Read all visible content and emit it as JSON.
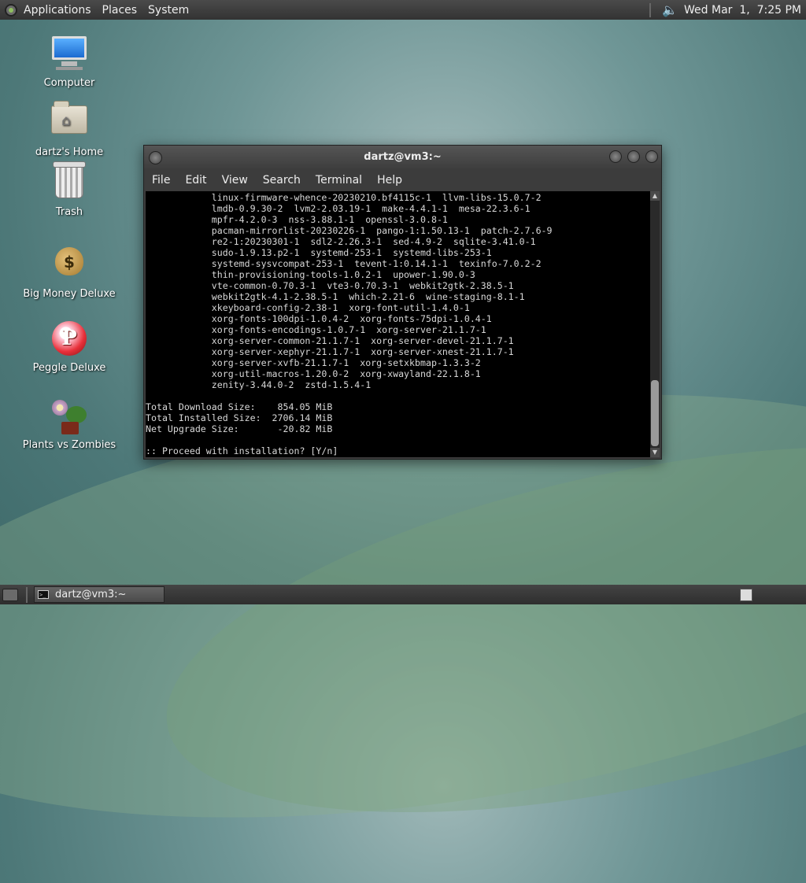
{
  "top_panel": {
    "menus": [
      "Applications",
      "Places",
      "System"
    ],
    "clock": "Wed Mar  1,  7:25 PM"
  },
  "desktop_icons": [
    {
      "label": "Computer",
      "icon": "computer-icon"
    },
    {
      "label": "dartz's Home",
      "icon": "home-folder-icon"
    },
    {
      "label": "Trash",
      "icon": "trash-icon"
    },
    {
      "label": "Big Money Deluxe",
      "icon": "money-bag-icon"
    },
    {
      "label": "Peggle Deluxe",
      "icon": "peggle-icon"
    },
    {
      "label": "Plants vs Zombies",
      "icon": "plants-vs-zombies-icon"
    }
  ],
  "terminal": {
    "title": "dartz@vm3:~",
    "menu": [
      "File",
      "Edit",
      "View",
      "Search",
      "Terminal",
      "Help"
    ],
    "output": "            linux-firmware-whence-20230210.bf4115c-1  llvm-libs-15.0.7-2\n            lmdb-0.9.30-2  lvm2-2.03.19-1  make-4.4.1-1  mesa-22.3.6-1\n            mpfr-4.2.0-3  nss-3.88.1-1  openssl-3.0.8-1\n            pacman-mirrorlist-20230226-1  pango-1:1.50.13-1  patch-2.7.6-9\n            re2-1:20230301-1  sdl2-2.26.3-1  sed-4.9-2  sqlite-3.41.0-1\n            sudo-1.9.13.p2-1  systemd-253-1  systemd-libs-253-1\n            systemd-sysvcompat-253-1  tevent-1:0.14.1-1  texinfo-7.0.2-2\n            thin-provisioning-tools-1.0.2-1  upower-1.90.0-3\n            vte-common-0.70.3-1  vte3-0.70.3-1  webkit2gtk-2.38.5-1\n            webkit2gtk-4.1-2.38.5-1  which-2.21-6  wine-staging-8.1-1\n            xkeyboard-config-2.38-1  xorg-font-util-1.4.0-1\n            xorg-fonts-100dpi-1.0.4-2  xorg-fonts-75dpi-1.0.4-1\n            xorg-fonts-encodings-1.0.7-1  xorg-server-21.1.7-1\n            xorg-server-common-21.1.7-1  xorg-server-devel-21.1.7-1\n            xorg-server-xephyr-21.1.7-1  xorg-server-xnest-21.1.7-1\n            xorg-server-xvfb-21.1.7-1  xorg-setxkbmap-1.3.3-2\n            xorg-util-macros-1.20.0-2  xorg-xwayland-22.1.8-1\n            zenity-3.44.0-2  zstd-1.5.4-1\n\nTotal Download Size:    854.05 MiB\nTotal Installed Size:  2706.14 MiB\nNet Upgrade Size:       -20.82 MiB\n\n:: Proceed with installation? [Y/n]"
  },
  "taskbar": {
    "task_label": "dartz@vm3:~"
  },
  "colors": {
    "terminal_bg": "#000000",
    "terminal_fg": "#d8d8d8",
    "panel_bg": "#3a3a3a"
  }
}
